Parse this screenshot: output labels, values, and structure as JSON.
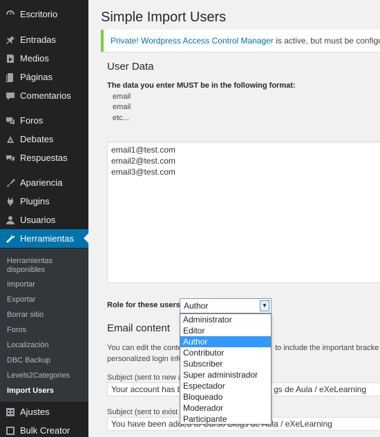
{
  "sidebar": {
    "items": [
      {
        "label": "Escritorio",
        "icon": "dashboard-icon"
      },
      {
        "label": "Entradas",
        "icon": "pin-icon"
      },
      {
        "label": "Medios",
        "icon": "media-icon"
      },
      {
        "label": "Páginas",
        "icon": "page-icon"
      },
      {
        "label": "Comentarios",
        "icon": "comment-icon"
      },
      {
        "label": "Foros",
        "icon": "forum-icon"
      },
      {
        "label": "Debates",
        "icon": "debate-icon"
      },
      {
        "label": "Respuestas",
        "icon": "replies-icon"
      },
      {
        "label": "Apariencia",
        "icon": "brush-icon"
      },
      {
        "label": "Plugins",
        "icon": "plug-icon"
      },
      {
        "label": "Usuarios",
        "icon": "user-icon"
      },
      {
        "label": "Herramientas",
        "icon": "wrench-icon"
      },
      {
        "label": "Ajustes",
        "icon": "settings-icon"
      },
      {
        "label": "Bulk Creator",
        "icon": "bulk-icon"
      }
    ],
    "submenu": [
      {
        "label": "Herramientas disponibles"
      },
      {
        "label": "Importar"
      },
      {
        "label": "Exportar"
      },
      {
        "label": "Borrar sitio"
      },
      {
        "label": "Foros"
      },
      {
        "label": "Localización"
      },
      {
        "label": "DBC Backup"
      },
      {
        "label": "Levels2Categories"
      },
      {
        "label": "Import Users"
      }
    ]
  },
  "main": {
    "title": "Simple Import Users",
    "notice_link": "Private! Wordpress Access Control Manager",
    "notice_text": " is active, but must be configured.",
    "user_data_title": "User Data",
    "instructions": "The data you enter MUST be in the following format:",
    "sample": [
      "email",
      "email",
      "etc..."
    ],
    "emails": [
      "email1@test.com",
      "email2@test.com",
      "email3@test.com"
    ],
    "role_label": "Role for these users:",
    "role_value": "Author",
    "role_options": [
      "Administrator",
      "Editor",
      "Author",
      "Contributor",
      "Subscriber",
      "Super administrador",
      "Espectador",
      "Bloqueado",
      "Moderador",
      "Participante"
    ],
    "email_content_title": "Email content",
    "email_desc_1": "You can edit the conte",
    "email_desc_1b": " to include the important bracke",
    "email_desc_2": "personalized login info",
    "subject_new_label": "Subject (sent to new a",
    "subject_new_value_a": "Your account has b",
    "subject_new_value_b": "gs de Aula / eXeLearning",
    "subject_existing_label": "Subject (sent to exist",
    "subject_existing_value": "You have been added to Curso Blogs de Aula / eXeLearning"
  }
}
